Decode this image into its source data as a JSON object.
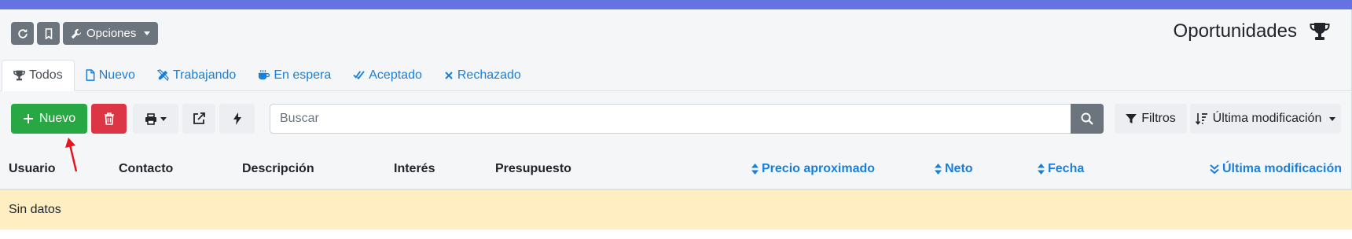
{
  "toolbar_top": {
    "options_label": "Opciones"
  },
  "page": {
    "title": "Oportunidades"
  },
  "tabs": [
    {
      "label": "Todos",
      "icon": "trophy-icon",
      "active": true
    },
    {
      "label": "Nuevo",
      "icon": "file-icon",
      "active": false
    },
    {
      "label": "Trabajando",
      "icon": "pencil-ruler-icon",
      "active": false
    },
    {
      "label": "En espera",
      "icon": "coffee-icon",
      "active": false
    },
    {
      "label": "Aceptado",
      "icon": "double-check-icon",
      "active": false
    },
    {
      "label": "Rechazado",
      "icon": "x-icon",
      "active": false
    }
  ],
  "toolbar": {
    "new_label": "Nuevo",
    "search_placeholder": "Buscar",
    "filters_label": "Filtros",
    "sort_label": "Última modificación"
  },
  "table": {
    "columns": [
      {
        "label": "Usuario",
        "sortable": false
      },
      {
        "label": "Contacto",
        "sortable": false
      },
      {
        "label": "Descripción",
        "sortable": false
      },
      {
        "label": "Interés",
        "sortable": false
      },
      {
        "label": "Presupuesto",
        "sortable": false
      },
      {
        "label": "Precio aproximado",
        "sortable": true
      },
      {
        "label": "Neto",
        "sortable": true
      },
      {
        "label": "Fecha",
        "sortable": true
      },
      {
        "label": "Última modificación",
        "sortable": true,
        "sorted": "desc"
      }
    ],
    "empty_text": "Sin datos"
  },
  "colors": {
    "accent": "#6672e1",
    "link": "#1a7fd8",
    "success": "#28a745",
    "danger": "#dc3545",
    "empty_row": "#ffeec2"
  }
}
